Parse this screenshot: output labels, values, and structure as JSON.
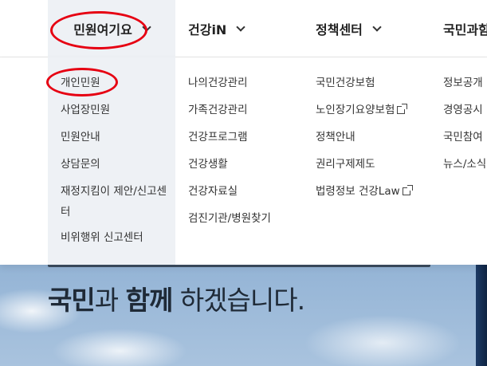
{
  "nav": {
    "items": [
      {
        "label": "민원여기요"
      },
      {
        "label": "건강iN"
      },
      {
        "label": "정책센터"
      },
      {
        "label": "국민과함"
      }
    ]
  },
  "menu": {
    "col1": [
      "개인민원",
      "사업장민원",
      "민원안내",
      "상담문의",
      "재정지킴이 제안/신고센터",
      "비위행위 신고센터"
    ],
    "col2": [
      "나의건강관리",
      "가족건강관리",
      "건강프로그램",
      "건강생활",
      "건강자료실",
      "검진기관/병원찾기"
    ],
    "col3": [
      "국민건강보험",
      "노인장기요양보험",
      "정책안내",
      "권리구제제도",
      "법령정보 건강Law"
    ],
    "col4": [
      "정보공개",
      "경영공시",
      "국민참여",
      "뉴스/소식"
    ]
  },
  "hero": {
    "line2_bold1": "국민",
    "line2_mid": "과 ",
    "line2_bold2": "함께",
    "line2_rest": " 하겠습니다."
  },
  "colors": {
    "annotation": "#e60012",
    "active_bg": "#eef1f5"
  }
}
